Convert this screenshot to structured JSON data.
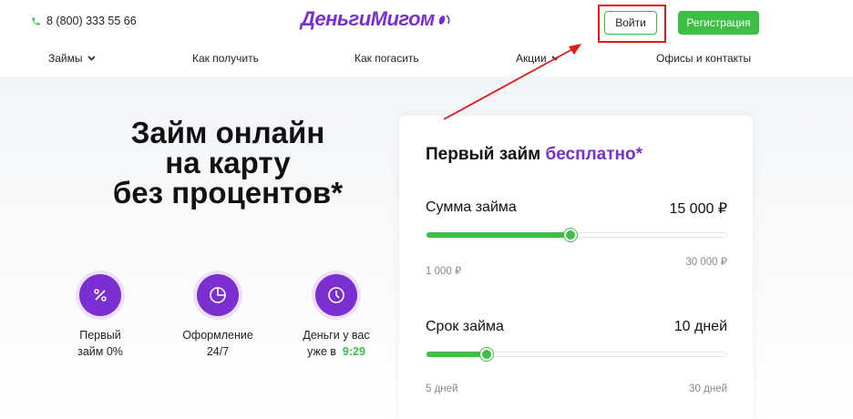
{
  "header": {
    "phone": "8 (800) 333 55 66",
    "logo": "ДеньгиМигом",
    "login_label": "Войти",
    "register_label": "Регистрация"
  },
  "nav": {
    "items": [
      {
        "label": "Займы"
      },
      {
        "label": "Как получить"
      },
      {
        "label": "Как погасить"
      },
      {
        "label": "Акции"
      },
      {
        "label": "Офисы и контакты"
      }
    ]
  },
  "hero": {
    "title_line1": "Займ онлайн",
    "title_line2": "на карту",
    "title_line3": "без процентов*",
    "features": [
      {
        "icon": "percent-icon",
        "line1": "Первый",
        "line2": "займ 0%"
      },
      {
        "icon": "pie-chart-icon",
        "line1": "Оформление",
        "line2": "24/7"
      },
      {
        "icon": "clock-icon",
        "line1": "Деньги у вас",
        "line2": "уже в",
        "time": "9:29"
      }
    ]
  },
  "calculator": {
    "title_main": "Первый займ ",
    "title_accent": "бесплатно*",
    "amount": {
      "label": "Сумма займа",
      "value": "15 000 ₽",
      "min": "1 000 ₽",
      "max": "30 000 ₽",
      "fraction": 0.48
    },
    "term": {
      "label": "Срок займа",
      "value": "10 дней",
      "min": "5 дней",
      "max": "30 дней",
      "fraction": 0.2
    }
  },
  "colors": {
    "accent": "#7b2fd0",
    "brand_green": "#3dbf46",
    "annotation_red": "#e01b1b"
  }
}
